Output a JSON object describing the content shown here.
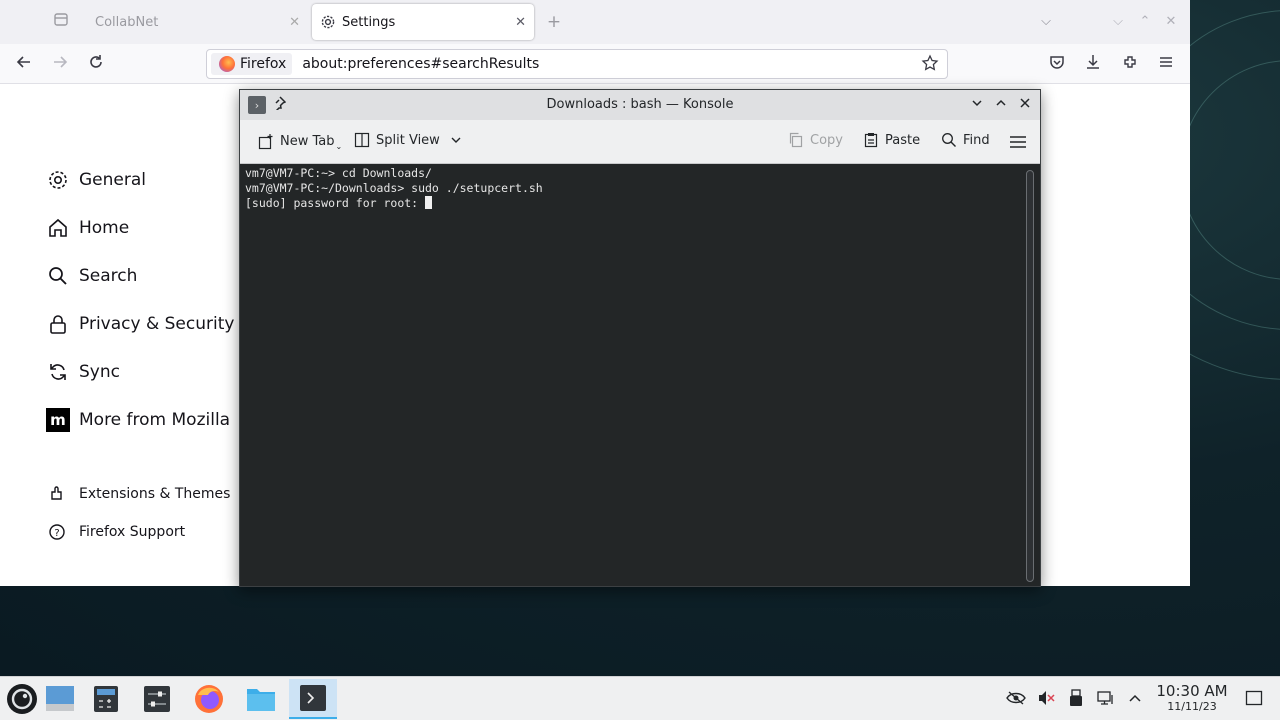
{
  "browser": {
    "tabs": [
      {
        "label": "CollabNet",
        "state": "inactive"
      },
      {
        "label": "Settings",
        "state": "active"
      }
    ],
    "url_identity": "Firefox",
    "url": "about:preferences#searchResults"
  },
  "settings_nav": {
    "items": [
      {
        "label": "General",
        "icon": "gear-icon"
      },
      {
        "label": "Home",
        "icon": "home-icon"
      },
      {
        "label": "Search",
        "icon": "search-icon"
      },
      {
        "label": "Privacy & Security",
        "icon": "lock-icon"
      },
      {
        "label": "Sync",
        "icon": "sync-icon"
      },
      {
        "label": "More from Mozilla",
        "icon": "mozilla-icon"
      }
    ],
    "footer": [
      {
        "label": "Extensions & Themes",
        "icon": "puzzle-icon"
      },
      {
        "label": "Firefox Support",
        "icon": "help-icon"
      }
    ]
  },
  "konsole": {
    "title": "Downloads : bash — Konsole",
    "toolbar": {
      "new_tab": "New Tab",
      "split_view": "Split View",
      "copy": "Copy",
      "paste": "Paste",
      "find": "Find"
    },
    "terminal_lines": [
      "vm7@VM7-PC:~> cd Downloads/",
      "vm7@VM7-PC:~/Downloads> sudo ./setupcert.sh",
      "[sudo] password for root: "
    ]
  },
  "taskbar": {
    "clock_time": "10:30 AM",
    "clock_date": "11/11/23"
  },
  "colors": {
    "accent": "#3daee9",
    "terminal_bg": "#232627",
    "firefox_tab_bg": "#f0f0f4"
  }
}
